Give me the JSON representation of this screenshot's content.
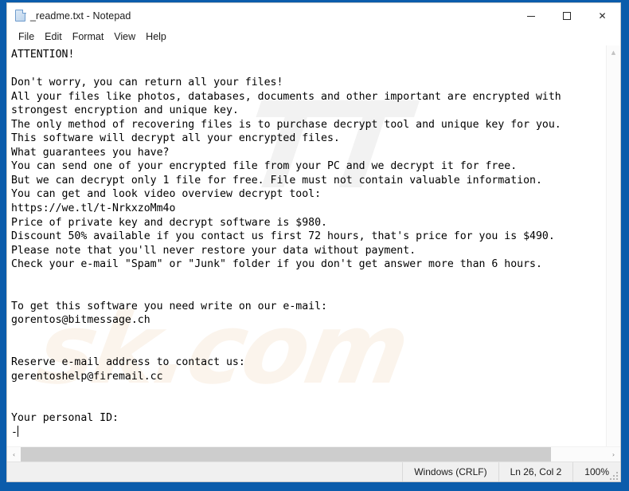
{
  "window": {
    "title": "_readme.txt - Notepad",
    "app_icon": "notepad-document-icon",
    "controls": {
      "minimize": "—",
      "maximize": "□",
      "close": "✕"
    }
  },
  "menubar": {
    "items": [
      {
        "label": "File"
      },
      {
        "label": "Edit"
      },
      {
        "label": "Format"
      },
      {
        "label": "View"
      },
      {
        "label": "Help"
      }
    ]
  },
  "editor": {
    "watermark_top": "TT",
    "watermark_bottom": "sk.com",
    "lines": [
      "ATTENTION!",
      "",
      "Don't worry, you can return all your files!",
      "All your files like photos, databases, documents and other important are encrypted with",
      "strongest encryption and unique key.",
      "The only method of recovering files is to purchase decrypt tool and unique key for you.",
      "This software will decrypt all your encrypted files.",
      "What guarantees you have?",
      "You can send one of your encrypted file from your PC and we decrypt it for free.",
      "But we can decrypt only 1 file for free. File must not contain valuable information.",
      "You can get and look video overview decrypt tool:",
      "https://we.tl/t-NrkxzoMm4o",
      "Price of private key and decrypt software is $980.",
      "Discount 50% available if you contact us first 72 hours, that's price for you is $490.",
      "Please note that you'll never restore your data without payment.",
      "Check your e-mail \"Spam\" or \"Junk\" folder if you don't get answer more than 6 hours.",
      "",
      "",
      "To get this software you need write on our e-mail:",
      "gorentos@bitmessage.ch",
      "",
      "",
      "Reserve e-mail address to contact us:",
      "gerentoshelp@firemail.cc",
      "",
      "",
      "Your personal ID:",
      "-"
    ],
    "full_text": "ATTENTION!\n\nDon't worry, you can return all your files!\nAll your files like photos, databases, documents and other important are encrypted with\nstrongest encryption and unique key.\nThe only method of recovering files is to purchase decrypt tool and unique key for you.\nThis software will decrypt all your encrypted files.\nWhat guarantees you have?\nYou can send one of your encrypted file from your PC and we decrypt it for free.\nBut we can decrypt only 1 file for free. File must not contain valuable information.\nYou can get and look video overview decrypt tool:\nhttps://we.tl/t-NrkxzoMm4o\nPrice of private key and decrypt software is $980.\nDiscount 50% available if you contact us first 72 hours, that's price for you is $490.\nPlease note that you'll never restore your data without payment.\nCheck your e-mail \"Spam\" or \"Junk\" folder if you don't get answer more than 6 hours.\n\n\nTo get this software you need write on our e-mail:\ngorentos@bitmessage.ch\n\n\nReserve e-mail address to contact us:\ngerentoshelp@firemail.cc\n\n\nYour personal ID:\n-"
  },
  "scrollbars": {
    "vertical_up_arrow": "▲",
    "vertical_down_arrow": "▼",
    "horizontal_left_arrow": "‹",
    "horizontal_right_arrow": "›"
  },
  "statusbar": {
    "encoding": "Windows (CRLF)",
    "cursor_position": "Ln 26, Col 2",
    "zoom": "100%"
  },
  "colors": {
    "desktop_blue": "#0b5cab",
    "window_bg": "#ffffff",
    "statusbar_bg": "#f0f0f0",
    "scrollbar_thumb": "#cdcdcd",
    "text": "#000000",
    "watermark_top": "#f2f2f2",
    "watermark_bottom": "#fbf4ec"
  }
}
